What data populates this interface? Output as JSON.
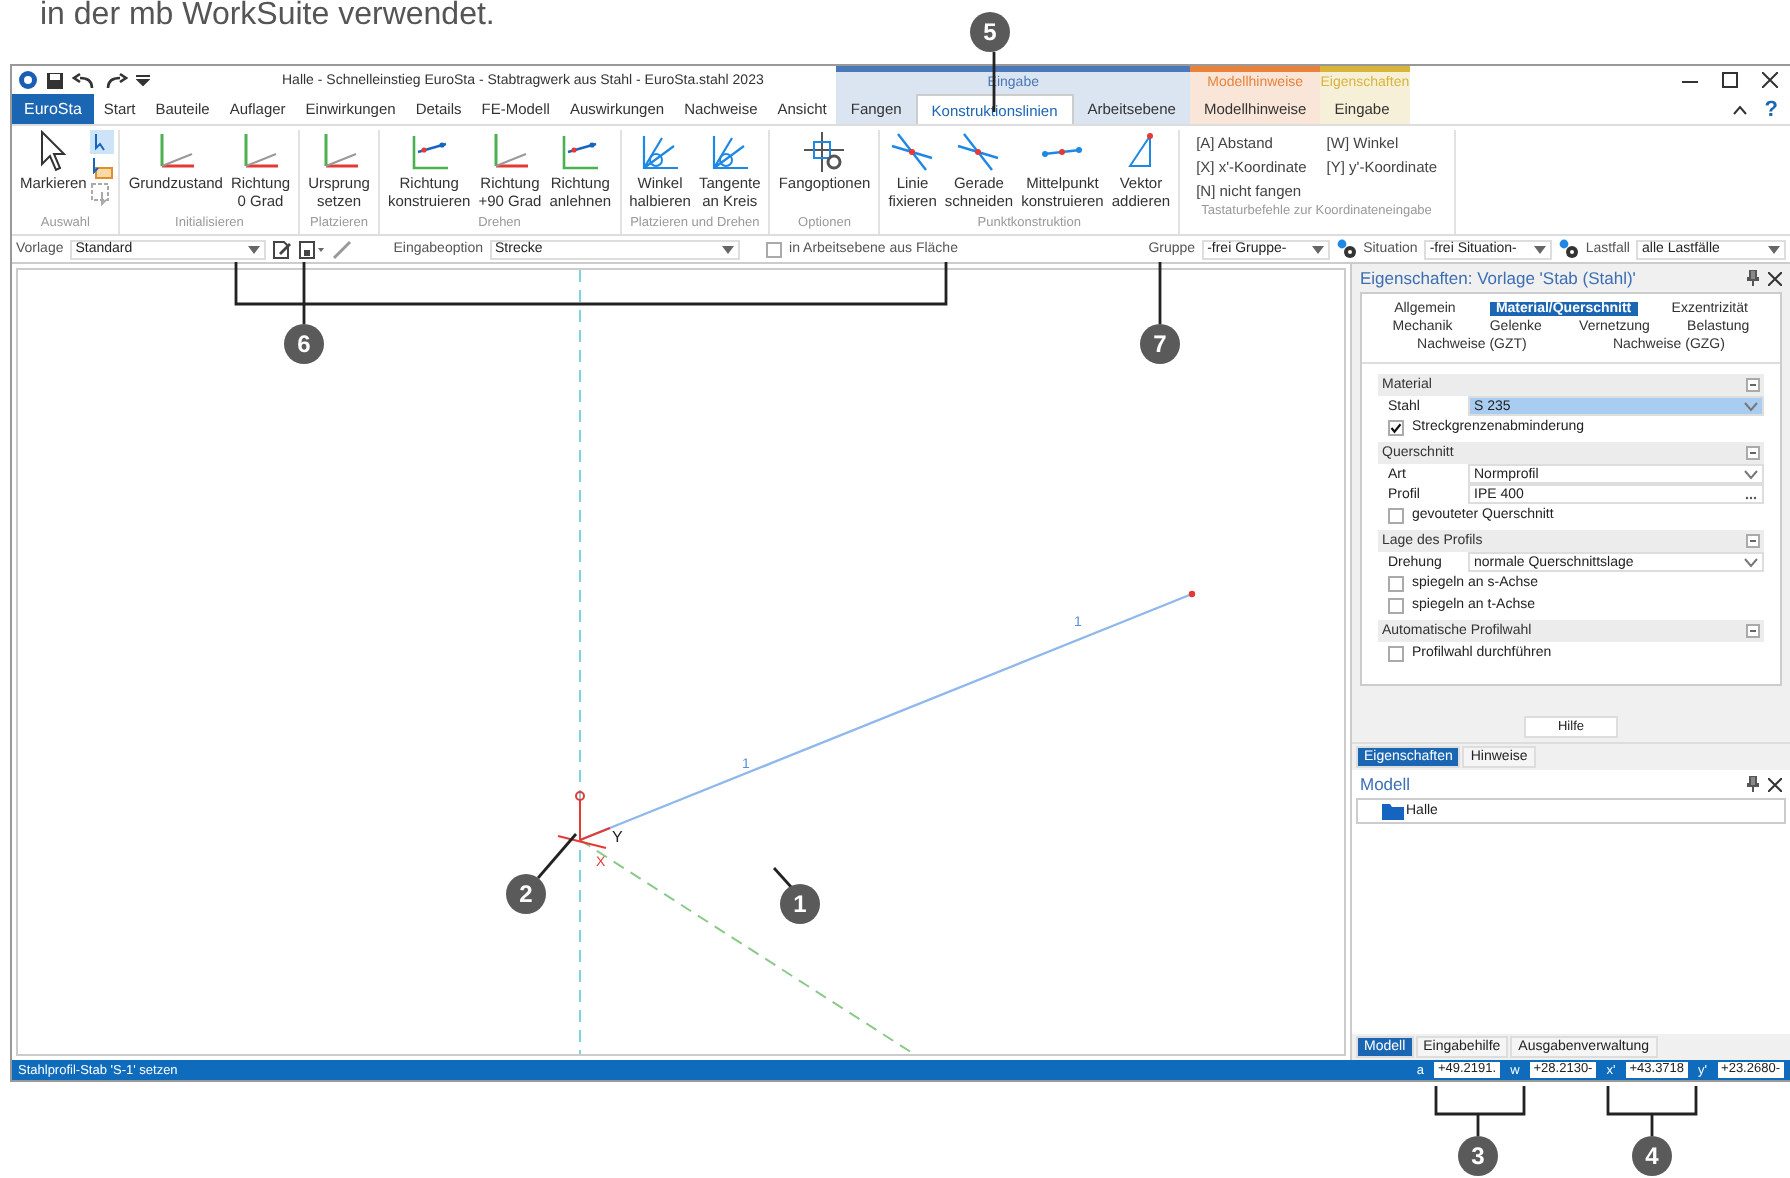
{
  "document_text": "in der mb WorkSuite verwendet.",
  "window": {
    "title": "Halle - Schnelleinstieg EuroSta - Stabtragwerk aus Stahl - EuroSta.stahl 2023",
    "help_glyph": "?"
  },
  "file_tab": "EuroSta",
  "tabs": [
    {
      "label": "Start",
      "selected": false
    },
    {
      "label": "Bauteile",
      "selected": false
    },
    {
      "label": "Auflager",
      "selected": false
    },
    {
      "label": "Einwirkungen",
      "selected": false
    },
    {
      "label": "Details",
      "selected": false
    },
    {
      "label": "FE-Modell",
      "selected": false
    },
    {
      "label": "Auswirkungen",
      "selected": false
    },
    {
      "label": "Nachweise",
      "selected": false
    },
    {
      "label": "Ansicht",
      "selected": false
    }
  ],
  "context_groups": [
    {
      "title": "Eingabe",
      "color": "#4a78b8",
      "tabs": [
        {
          "label": "Fangen",
          "selected": false
        },
        {
          "label": "Konstruktionslinien",
          "selected": true
        },
        {
          "label": "Arbeitsebene",
          "selected": false
        }
      ]
    },
    {
      "title": "Modellhinweise",
      "color": "#e8823a",
      "tabs": [
        {
          "label": "Modellhinweise",
          "selected": false
        }
      ]
    },
    {
      "title": "Eigenschaften",
      "color": "#d9b43a",
      "tabs": [
        {
          "label": "Eingabe",
          "selected": false
        }
      ]
    }
  ],
  "ribbon_groups": [
    {
      "label": "Auswahl",
      "buttons": [
        {
          "label": "Markieren",
          "kind": "pointer"
        }
      ]
    },
    {
      "label": "Initialisieren",
      "buttons": [
        {
          "label": "Grundzustand",
          "kind": "axes"
        },
        {
          "label": "Richtung\n0 Grad",
          "kind": "axes"
        }
      ]
    },
    {
      "label": "Platzieren",
      "buttons": [
        {
          "label": "Ursprung\nsetzen",
          "kind": "axes"
        }
      ]
    },
    {
      "label": "Drehen",
      "buttons": [
        {
          "label": "Richtung\nkonstruieren",
          "kind": "direction"
        },
        {
          "label": "Richtung\n+90 Grad",
          "kind": "axes"
        },
        {
          "label": "Richtung\nanlehnen",
          "kind": "direction"
        }
      ]
    },
    {
      "label": "Platzieren und Drehen",
      "buttons": [
        {
          "label": "Winkel\nhalbieren",
          "kind": "bisect"
        },
        {
          "label": "Tangente\nan Kreis",
          "kind": "bisect"
        }
      ]
    },
    {
      "label": "Optionen",
      "buttons": [
        {
          "label": "Fangoptionen",
          "kind": "crosshair"
        }
      ]
    },
    {
      "label": "Punktkonstruktion",
      "buttons": [
        {
          "label": "Linie\nfixieren",
          "kind": "intersect"
        },
        {
          "label": "Gerade\nschneiden",
          "kind": "intersect"
        },
        {
          "label": "Mittelpunkt\nkonstruieren",
          "kind": "midpoint"
        },
        {
          "label": "Vektor\naddieren",
          "kind": "vector"
        }
      ]
    }
  ],
  "shortcuts": {
    "label": "Tastaturbefehle zur Koordinateneingabe",
    "items": [
      "[A] Abstand",
      "[W] Winkel",
      "[X] x'-Koordinate",
      "[Y] y'-Koordinate",
      "[N] nicht fangen"
    ]
  },
  "toolbar": {
    "vorlage_label": "Vorlage",
    "vorlage": "Standard",
    "option_label": "Eingabeoption",
    "option": "Strecke",
    "plane_check": {
      "label": "in Arbeitsebene aus Fläche",
      "checked": false
    },
    "gruppe_label": "Gruppe",
    "gruppe": "-frei Gruppe-",
    "situation_label": "Situation",
    "situation": "-frei Situation-",
    "lastfall_label": "Lastfall",
    "lastfall": "alle Lastfälle"
  },
  "canvas": {
    "axis_y": "Y",
    "axis_x": "X",
    "member_labels": [
      "1",
      "1"
    ]
  },
  "properties": {
    "title": "Eigenschaften: Vorlage 'Stab (Stahl)'",
    "tab_rows": [
      [
        {
          "label": "Allgemein",
          "selected": false
        },
        {
          "label": "Material/Querschnitt",
          "selected": true
        },
        {
          "label": "Exzentrizität",
          "selected": false
        }
      ],
      [
        {
          "label": "Mechanik",
          "selected": false
        },
        {
          "label": "Gelenke",
          "selected": false
        },
        {
          "label": "Vernetzung",
          "selected": false
        },
        {
          "label": "Belastung",
          "selected": false
        }
      ],
      [
        {
          "label": "Nachweise (GZT)",
          "selected": false
        },
        {
          "label": "Nachweise (GZG)",
          "selected": false
        }
      ]
    ],
    "sections": [
      {
        "title": "Material",
        "rows": [
          {
            "kind": "combo",
            "label": "Stahl",
            "value": "S 235",
            "selected": true
          },
          {
            "kind": "check",
            "label": "Streckgrenzenabminderung",
            "checked": true
          }
        ]
      },
      {
        "title": "Querschnitt",
        "rows": [
          {
            "kind": "combo",
            "label": "Art",
            "value": "Normprofil",
            "selected": false
          },
          {
            "kind": "more",
            "label": "Profil",
            "value": "IPE 400",
            "selected": false
          },
          {
            "kind": "check",
            "label": "gevouteter Querschnitt",
            "checked": false
          }
        ]
      },
      {
        "title": "Lage des Profils",
        "rows": [
          {
            "kind": "combo",
            "label": "Drehung",
            "value": "normale Querschnittslage",
            "selected": false
          },
          {
            "kind": "check",
            "label": "spiegeln an s-Achse",
            "checked": false
          },
          {
            "kind": "check",
            "label": "spiegeln an t-Achse",
            "checked": false
          }
        ]
      },
      {
        "title": "Automatische Profilwahl",
        "rows": [
          {
            "kind": "check",
            "label": "Profilwahl durchführen",
            "checked": false
          }
        ]
      }
    ],
    "help_button": "Hilfe",
    "panel_tabs": [
      {
        "label": "Eigenschaften",
        "selected": true
      },
      {
        "label": "Hinweise",
        "selected": false
      }
    ]
  },
  "model": {
    "title": "Modell",
    "tree": [
      {
        "label": "Halle"
      }
    ],
    "bottom_tabs": [
      {
        "label": "Modell",
        "selected": true
      },
      {
        "label": "Eingabehilfe",
        "selected": false
      },
      {
        "label": "Ausgabenverwaltung",
        "selected": false
      }
    ]
  },
  "status_bar": {
    "message": "Stahlprofil-Stab 'S-1' setzen",
    "fields": [
      {
        "label": "a",
        "value": "+49.2191."
      },
      {
        "label": "w",
        "value": "+28.2130-"
      },
      {
        "label": "x'",
        "value": "+43.3718"
      },
      {
        "label": "y'",
        "value": "+23.2680-"
      }
    ]
  },
  "callouts": [
    "1",
    "2",
    "3",
    "4",
    "5",
    "6",
    "7"
  ]
}
